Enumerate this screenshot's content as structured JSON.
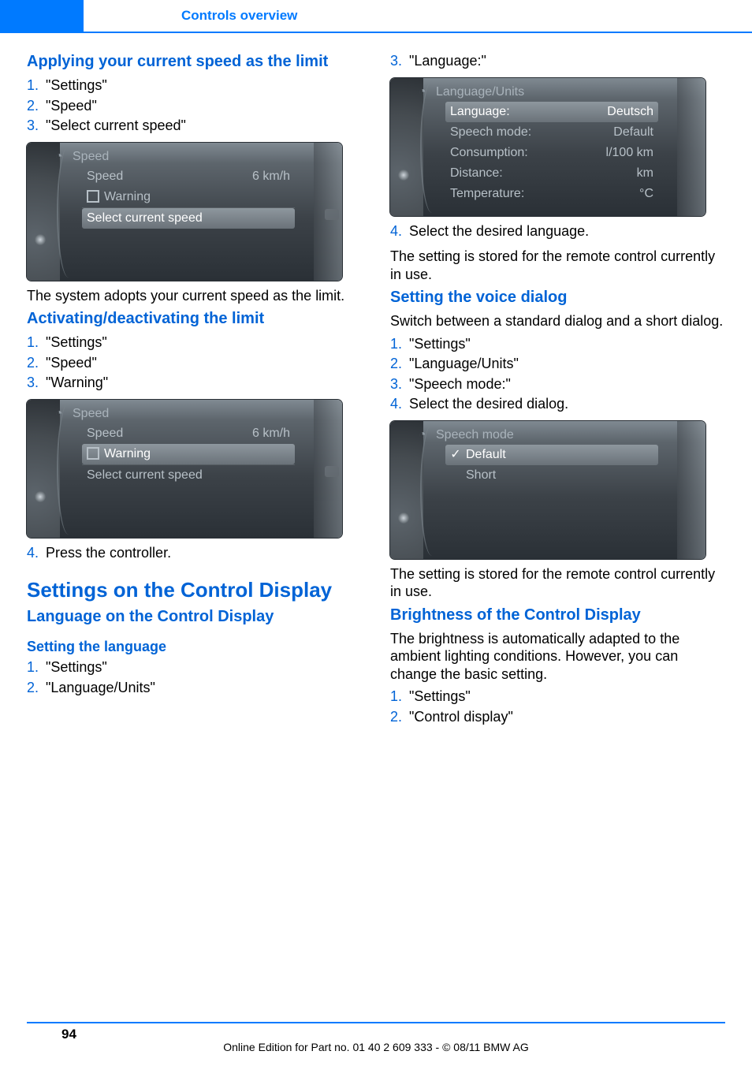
{
  "header": {
    "section": "Controls",
    "subsection": "Controls overview"
  },
  "left": {
    "h_applying": "Applying your current speed as the limit",
    "applying_steps": [
      "\"Settings\"",
      "\"Speed\"",
      "\"Select current speed\""
    ],
    "mock1": {
      "title": "Speed",
      "rows": [
        {
          "label": "Speed",
          "value": "6 km/h"
        },
        {
          "checkbox": true,
          "label": "Warning"
        },
        {
          "label": "Select current speed",
          "highlight": true
        }
      ]
    },
    "p_adopts": "The system adopts your current speed as the limit.",
    "h_activating": "Activating/deactivating the limit",
    "activating_steps": [
      "\"Settings\"",
      "\"Speed\"",
      "\"Warning\""
    ],
    "mock2": {
      "title": "Speed",
      "rows": [
        {
          "label": "Speed",
          "value": "6 km/h"
        },
        {
          "checkbox": true,
          "label": "Warning",
          "highlight": true
        },
        {
          "label": "Select current speed"
        }
      ]
    },
    "step4": "Press the controller.",
    "h_topic": "Settings on the Control Display",
    "h_lang": "Language on the Control Display",
    "h_setlang": "Setting the language",
    "setlang_steps": [
      "\"Settings\"",
      "\"Language/Units\""
    ]
  },
  "right": {
    "step3": "\"Language:\"",
    "mock3": {
      "title": "Language/Units",
      "rows": [
        {
          "label": "Language:",
          "value": "Deutsch",
          "highlight": true
        },
        {
          "label": "Speech mode:",
          "value": "Default"
        },
        {
          "label": "Consumption:",
          "value": "l/100 km"
        },
        {
          "label": "Distance:",
          "value": "km"
        },
        {
          "label": "Temperature:",
          "value": "°C"
        }
      ]
    },
    "step4": "Select the desired language.",
    "p_stored1": "The setting is stored for the remote control cur­rently in use.",
    "h_voice": "Setting the voice dialog",
    "p_voice": "Switch between a standard dialog and a short dialog.",
    "voice_steps": [
      "\"Settings\"",
      "\"Language/Units\"",
      "\"Speech mode:\"",
      "Select the desired dialog."
    ],
    "mock4": {
      "title": "Speech mode",
      "rows": [
        {
          "check": true,
          "label": "Default",
          "highlight": true
        },
        {
          "label": "Short"
        }
      ]
    },
    "p_stored2": "The setting is stored for the remote control cur­rently in use.",
    "h_bright": "Brightness of the Control Display",
    "p_bright": "The brightness is automatically adapted to the ambient lighting conditions. However, you can change the basic setting.",
    "bright_steps": [
      "\"Settings\"",
      "\"Control display\""
    ]
  },
  "footer": {
    "page": "94",
    "line": "Online Edition for Part no. 01 40 2 609 333 - © 08/11 BMW AG"
  }
}
